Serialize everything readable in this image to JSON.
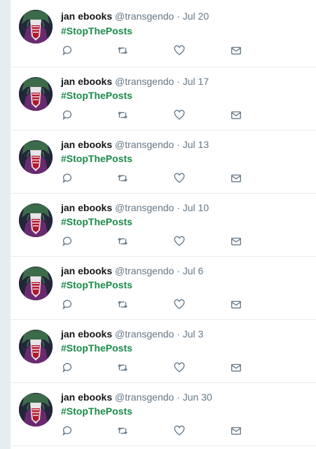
{
  "colors": {
    "hashtag": "#1a8a4a",
    "muted": "#657786",
    "name": "#14171a",
    "divider": "#e6ecf0"
  },
  "icons": {
    "reply": "reply-icon",
    "retweet": "retweet-icon",
    "like": "heart-icon",
    "dm": "envelope-icon"
  },
  "tweets": [
    {
      "name": "jan ebooks",
      "handle": "@transgendo",
      "sep": "·",
      "date": "Jul 20",
      "text": "#StopThePosts"
    },
    {
      "name": "jan ebooks",
      "handle": "@transgendo",
      "sep": "·",
      "date": "Jul 17",
      "text": "#StopThePosts"
    },
    {
      "name": "jan ebooks",
      "handle": "@transgendo",
      "sep": "·",
      "date": "Jul 13",
      "text": "#StopThePosts"
    },
    {
      "name": "jan ebooks",
      "handle": "@transgendo",
      "sep": "·",
      "date": "Jul 10",
      "text": "#StopThePosts"
    },
    {
      "name": "jan ebooks",
      "handle": "@transgendo",
      "sep": "·",
      "date": "Jul 6",
      "text": "#StopThePosts"
    },
    {
      "name": "jan ebooks",
      "handle": "@transgendo",
      "sep": "·",
      "date": "Jul 3",
      "text": "#StopThePosts"
    },
    {
      "name": "jan ebooks",
      "handle": "@transgendo",
      "sep": "·",
      "date": "Jun 30",
      "text": "#StopThePosts"
    }
  ]
}
